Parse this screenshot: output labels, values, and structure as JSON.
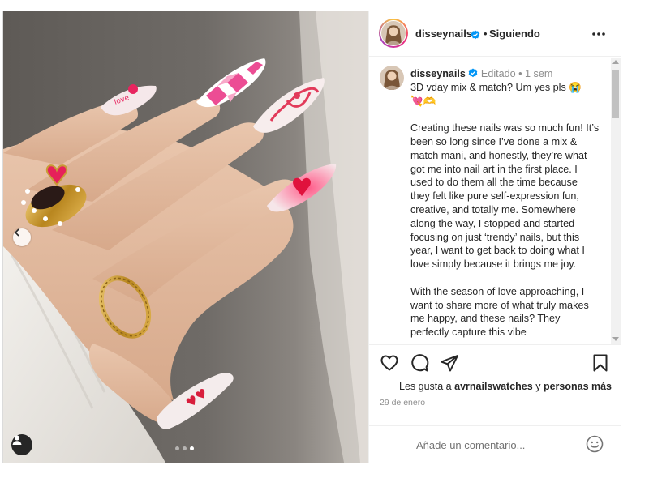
{
  "post": {
    "username": "disseynails",
    "separator": "•",
    "follow_status": "Siguiendo",
    "edited_label": "Editado •",
    "time_ago": "1 sem",
    "caption_line1": "3D vday mix & match? Um yes pls 😭",
    "caption_line2": "💘🫶",
    "caption_para1": "Creating these nails was so much fun! It’s been so long since I’ve done a mix & match mani, and honestly, they’re what got me into nail art in the first place. I used to do them all the time because they felt like pure self-expression fun, creative, and totally me. Somewhere along the way, I stopped and started focusing on just ‘trendy’ nails, but this year, I want to get back to doing what I love simply because it brings me joy.",
    "caption_para2": "With the season of love approaching, I want to share more of what truly makes me happy, and these nails? They perfectly capture this vibe"
  },
  "likes": {
    "prefix": "Les gusta a",
    "user": "avrnailswatches",
    "connector": "y",
    "others": "personas más"
  },
  "date": "29 de enero",
  "comment": {
    "placeholder": "Añade un comentario..."
  },
  "carousel": {
    "count": 3,
    "active_index": 2
  },
  "icons": {
    "header": [
      "verified-icon",
      "more-options-icon"
    ],
    "actions": [
      "heart-icon",
      "comment-icon",
      "share-icon",
      "bookmark-icon"
    ],
    "photo": [
      "prev-arrow-icon",
      "user-tag-icon"
    ],
    "comment": [
      "emoji-icon"
    ]
  },
  "colors": {
    "verified": "#0095f6",
    "text": "#262626",
    "meta": "#8e8e8e"
  }
}
